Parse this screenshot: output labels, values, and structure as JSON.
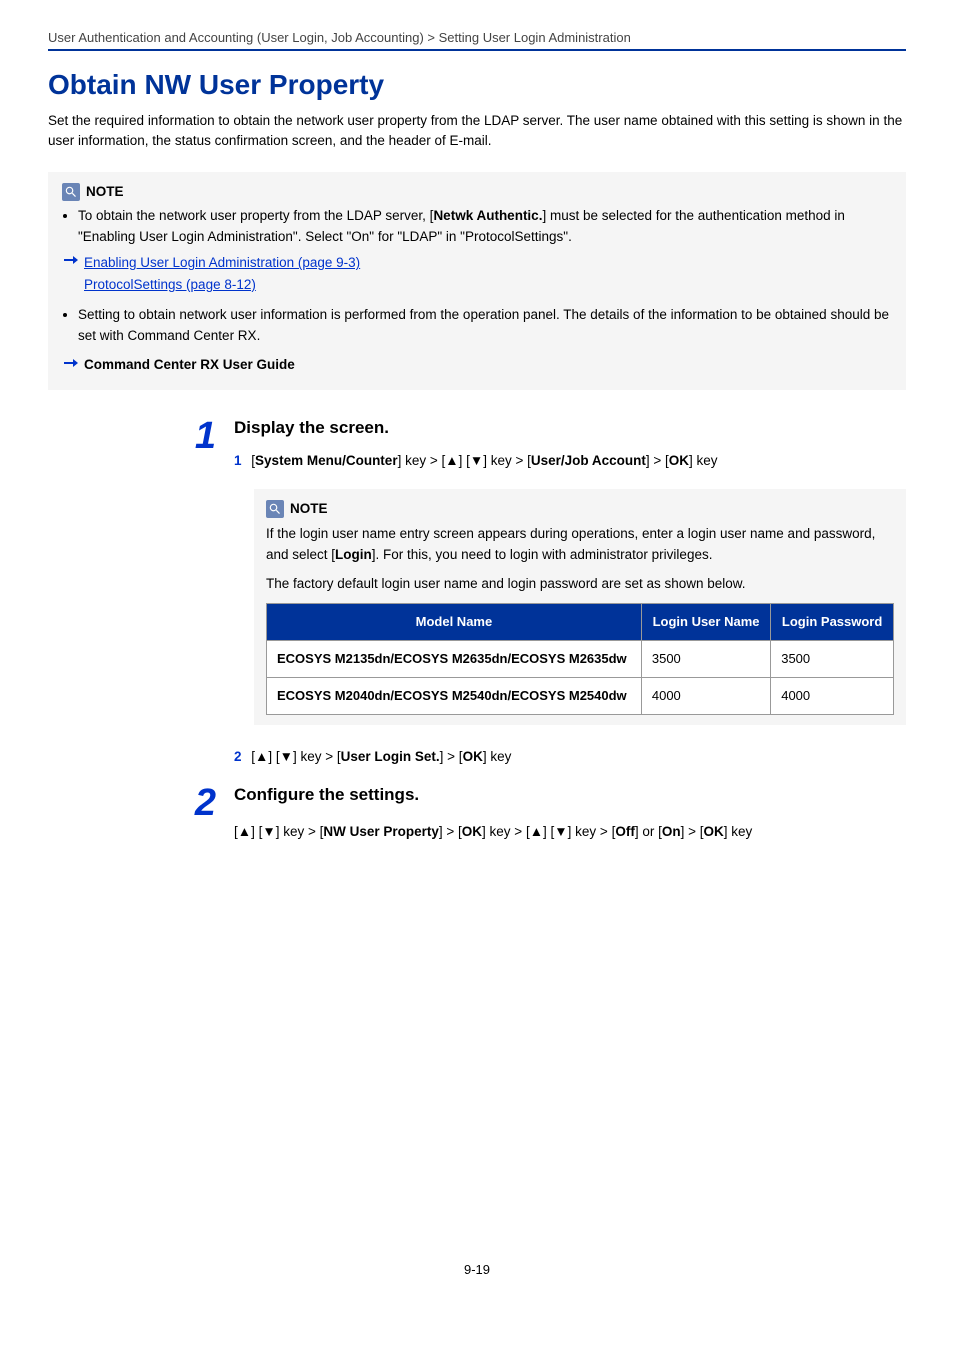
{
  "breadcrumb": "User Authentication and Accounting (User Login, Job Accounting) > Setting User Login Administration",
  "title": "Obtain NW User Property",
  "intro": "Set the required information to obtain the network user property from the LDAP server. The user name obtained with this setting is shown in the user information, the status confirmation screen, and the header of E-mail.",
  "note1": {
    "label": "NOTE",
    "bullet1_pre": "To obtain the network user property from the LDAP server, [",
    "bullet1_bold": "Netwk Authentic.",
    "bullet1_post": "] must be selected for the authentication method in \"Enabling User Login Administration\". Select \"On\" for \"LDAP\" in \"ProtocolSettings\".",
    "link1": "Enabling User Login Administration (page 9-3)",
    "link2": "ProtocolSettings (page 8-12)",
    "bullet2": "Setting to obtain network user information is performed from the operation panel. The details of the information to be obtained should be set with Command Center RX.",
    "ref": "Command Center RX User Guide"
  },
  "step1": {
    "num": "1",
    "head": "Display the screen.",
    "sub1": {
      "num": "1",
      "pre": "[",
      "b1": "System Menu/Counter",
      "mid1": "] key > [▲] [▼] key > [",
      "b2": "User/Job Account",
      "mid2": "] > [",
      "b3": "OK",
      "post": "] key"
    },
    "innerNote": {
      "label": "NOTE",
      "p1_pre": "If the login user name entry screen appears during operations, enter a login user name and password, and select [",
      "p1_bold": "Login",
      "p1_post": "]. For this, you need to login with administrator privileges.",
      "p2": "The factory default login user name and login password are set as shown below."
    },
    "table": {
      "h1": "Model Name",
      "h2": "Login User Name",
      "h3": "Login Password",
      "rows": [
        {
          "model": "ECOSYS M2135dn/ECOSYS M2635dn/ECOSYS M2635dw",
          "user": "3500",
          "pass": "3500"
        },
        {
          "model": "ECOSYS M2040dn/ECOSYS M2540dn/ECOSYS M2540dw",
          "user": "4000",
          "pass": "4000"
        }
      ]
    },
    "sub2": {
      "num": "2",
      "pre": "[▲] [▼] key > [",
      "b1": "User Login Set.",
      "mid1": "] > [",
      "b2": "OK",
      "post": "] key"
    }
  },
  "step2": {
    "num": "2",
    "head": "Configure the settings.",
    "line": {
      "pre": "[▲] [▼] key > [",
      "b1": "NW User Property",
      "mid1": "] > [",
      "b2": "OK",
      "mid2": "] key > [▲] [▼] key > [",
      "b3": "Off",
      "mid3": "] or [",
      "b4": "On",
      "mid4": "] > [",
      "b5": "OK",
      "post": "] key"
    }
  },
  "pageNum": "9-19"
}
